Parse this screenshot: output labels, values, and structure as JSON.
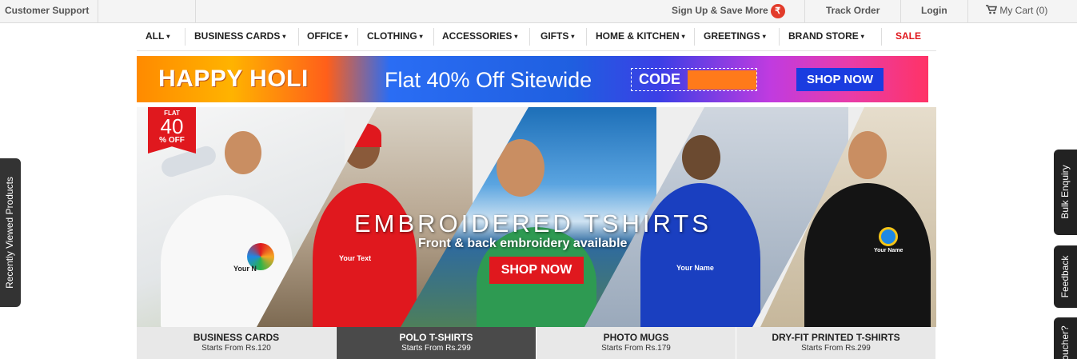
{
  "topbar": {
    "customer_support": "Customer Support",
    "signup": "Sign Up & Save More",
    "rupee_icon": "rupee-icon",
    "track_order": "Track Order",
    "login": "Login",
    "cart": "My Cart (0)",
    "cart_icon": "cart-icon"
  },
  "nav": {
    "items": [
      {
        "label": "ALL"
      },
      {
        "label": "BUSINESS CARDS"
      },
      {
        "label": "OFFICE"
      },
      {
        "label": "CLOTHING"
      },
      {
        "label": "ACCESSORIES"
      },
      {
        "label": "GIFTS"
      },
      {
        "label": "HOME & KITCHEN"
      },
      {
        "label": "GREETINGS"
      },
      {
        "label": "BRAND STORE"
      },
      {
        "label": "SALE"
      }
    ],
    "caret": "▾",
    "sale_color": "#e0181e"
  },
  "promo": {
    "headline": "HAPPY HOLI",
    "offer": "Flat 40% Off Sitewide",
    "code_label": "CODE",
    "shop_now": "SHOP NOW"
  },
  "hero": {
    "badge_top": "FLAT",
    "badge_value": "40",
    "badge_bottom": "% OFF",
    "title": "EMBROIDERED TSHIRTS",
    "subtitle": "Front & back embroidery available",
    "shop_now": "SHOP NOW",
    "print_labels": [
      "Your N",
      "Your Text",
      "Your Name",
      "Your Name"
    ]
  },
  "tabs": [
    {
      "title": "BUSINESS CARDS",
      "from": "Starts From Rs.120",
      "active": false
    },
    {
      "title": "POLO T-SHIRTS",
      "from": "Starts From Rs.299",
      "active": true
    },
    {
      "title": "PHOTO MUGS",
      "from": "Starts From Rs.179",
      "active": false
    },
    {
      "title": "DRY-FIT PRINTED T-SHIRTS",
      "from": "Starts From Rs.299",
      "active": false
    }
  ],
  "side": {
    "recently_viewed": "Recently Viewed Products",
    "bulk_enquiry": "Bulk Enquiry",
    "feedback": "Feedback",
    "voucher": "oucher?"
  },
  "colors": {
    "accent_red": "#e0181e",
    "promo_blue": "#1a3ce0"
  }
}
